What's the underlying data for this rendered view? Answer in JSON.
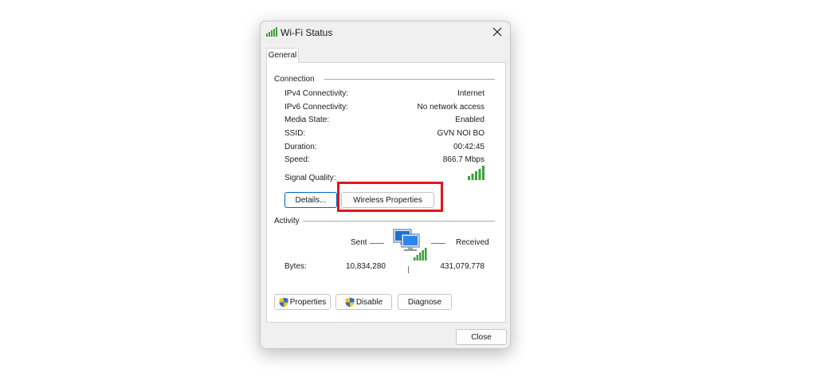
{
  "window": {
    "title": "Wi-Fi Status"
  },
  "tabs": [
    {
      "label": "General"
    }
  ],
  "connection": {
    "section_label": "Connection",
    "rows": [
      {
        "label": "IPv4 Connectivity:",
        "value": "Internet"
      },
      {
        "label": "IPv6 Connectivity:",
        "value": "No network access"
      },
      {
        "label": "Media State:",
        "value": "Enabled"
      },
      {
        "label": "SSID:",
        "value": "GVN NOI BO"
      },
      {
        "label": "Duration:",
        "value": "00:42:45"
      },
      {
        "label": "Speed:",
        "value": "866.7 Mbps"
      }
    ],
    "signal_quality_label": "Signal Quality:",
    "signal_bars": 5,
    "details_button": "Details...",
    "wireless_properties_button": "Wireless Properties"
  },
  "activity": {
    "section_label": "Activity",
    "sent_label": "Sent",
    "received_label": "Received",
    "bytes_label": "Bytes:",
    "bytes_sent": "10,834,280",
    "bytes_received": "431,079,778"
  },
  "buttons": {
    "properties": "Properties",
    "disable": "Disable",
    "diagnose": "Diagnose",
    "close": "Close"
  },
  "colors": {
    "highlight": "#e3161b",
    "signal_green": "#3aa13a",
    "default_button_border": "#0067c0"
  }
}
